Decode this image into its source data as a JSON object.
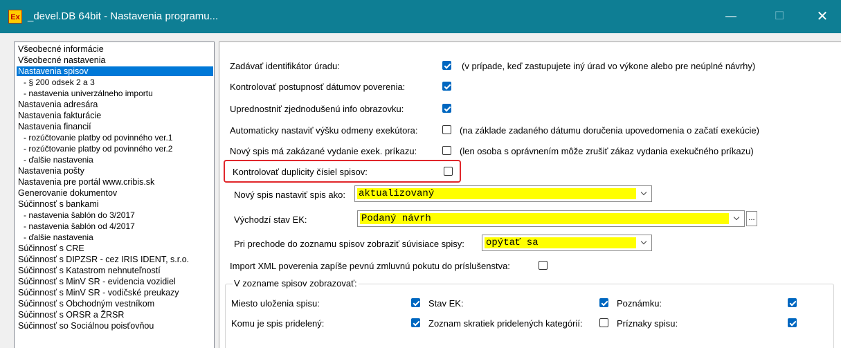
{
  "window": {
    "title": "_devel.DB 64bit - Nastavenia programu...",
    "icon_text": "Ex",
    "minimize_glyph": "—",
    "maximize_glyph": "☐",
    "close_glyph": "✕"
  },
  "sidebar": {
    "items": [
      {
        "label": "Všeobecné informácie",
        "sub": false,
        "selected": false
      },
      {
        "label": "Všeobecné nastavenia",
        "sub": false,
        "selected": false
      },
      {
        "label": "Nastavenia spisov",
        "sub": false,
        "selected": true
      },
      {
        "label": "- § 200 odsek 2 a 3",
        "sub": true,
        "selected": false
      },
      {
        "label": "- nastavenia univerzálneho importu",
        "sub": true,
        "selected": false
      },
      {
        "label": "Nastavenia adresára",
        "sub": false,
        "selected": false
      },
      {
        "label": "Nastavenia fakturácie",
        "sub": false,
        "selected": false
      },
      {
        "label": "Nastavenia financií",
        "sub": false,
        "selected": false
      },
      {
        "label": "- rozúčtovanie platby od povinného ver.1",
        "sub": true,
        "selected": false
      },
      {
        "label": "- rozúčtovanie platby od povinného ver.2",
        "sub": true,
        "selected": false
      },
      {
        "label": "- ďalšie nastavenia",
        "sub": true,
        "selected": false
      },
      {
        "label": "Nastavenia pošty",
        "sub": false,
        "selected": false
      },
      {
        "label": "Nastavenia pre portál www.cribis.sk",
        "sub": false,
        "selected": false
      },
      {
        "label": "Generovanie dokumentov",
        "sub": false,
        "selected": false
      },
      {
        "label": "Súčinnosť s bankami",
        "sub": false,
        "selected": false
      },
      {
        "label": "- nastavenia šablón do 3/2017",
        "sub": true,
        "selected": false
      },
      {
        "label": "- nastavenia šablón od 4/2017",
        "sub": true,
        "selected": false
      },
      {
        "label": "- ďalšie nastavenia",
        "sub": true,
        "selected": false
      },
      {
        "label": "Súčinnosť s CRE",
        "sub": false,
        "selected": false
      },
      {
        "label": "Súčinnosť s DIPZSR - cez IRIS IDENT, s.r.o.",
        "sub": false,
        "selected": false
      },
      {
        "label": "Súčinnosť s Katastrom nehnuteľností",
        "sub": false,
        "selected": false
      },
      {
        "label": "Súčinnosť s MinV SR - evidencia vozidiel",
        "sub": false,
        "selected": false
      },
      {
        "label": "Súčinnosť s MinV SR - vodičské preukazy",
        "sub": false,
        "selected": false
      },
      {
        "label": "Súčinnosť s Obchodným vestníkom",
        "sub": false,
        "selected": false
      },
      {
        "label": "Súčinnosť s ORSR a ŽRSR",
        "sub": false,
        "selected": false
      },
      {
        "label": "Súčinnosť so Sociálnou poisťovňou",
        "sub": false,
        "selected": false
      }
    ]
  },
  "settings": {
    "zadavat_id": {
      "label": "Zadávať identifikátor úradu:",
      "checked": true,
      "note": "(v prípade, keď zastupujete iný úrad vo výkone alebo pre neúplné návrhy)"
    },
    "kontrolovat_postupnost": {
      "label": "Kontrolovať postupnosť dátumov poverenia:",
      "checked": true
    },
    "uprednostnit": {
      "label": "Uprednostniť zjednodušenú info obrazovku:",
      "checked": true
    },
    "automaticky": {
      "label": "Automaticky nastaviť výšku odmeny exekútora:",
      "checked": false,
      "note": "(na základe zadaného dátumu doručenia upovedomenia o začatí exekúcie)"
    },
    "novy_spis_zakazane": {
      "label": "Nový spis má zakázané vydanie exek. príkazu:",
      "checked": false,
      "note": "(len osoba s oprávnením môže zrušiť zákaz vydania exekučného príkazu)"
    },
    "kontrolovat_duplicity": {
      "label": "Kontrolovať duplicity čísiel spisov:",
      "checked": false
    },
    "novy_spis_nastavit": {
      "label": "Nový spis nastaviť spis ako:",
      "value": "aktualizovaný"
    },
    "vychodzi_stav": {
      "label": "Východzí stav EK:",
      "value": "Podaný návrh",
      "ellipsis": "..."
    },
    "pri_prechode": {
      "label": "Pri prechode do zoznamu spisov zobraziť súvisiace spisy:",
      "value": "opýtať sa"
    },
    "import_xml": {
      "label": "Import XML poverenia zapíše pevnú zmluvnú pokutu do príslušenstva:",
      "checked": false
    }
  },
  "zoznam_group": {
    "legend": "V zozname spisov zobrazovať:",
    "items": [
      {
        "label": "Miesto uloženia spisu:",
        "checked": true
      },
      {
        "label": "Stav EK:",
        "checked": true
      },
      {
        "label": "Poznámku:",
        "checked": true
      },
      {
        "label": "Komu je spis pridelený:",
        "checked": true
      },
      {
        "label": "Zoznam skratiek pridelených kategórií:",
        "checked": false
      },
      {
        "label": "Príznaky spisu:",
        "checked": true
      }
    ]
  },
  "colors": {
    "titlebar": "#0e7e94",
    "selection": "#0078d7",
    "checkbox_checked": "#0067c0",
    "combo_highlight": "#ffff00",
    "highlight_border": "#e0262b"
  }
}
